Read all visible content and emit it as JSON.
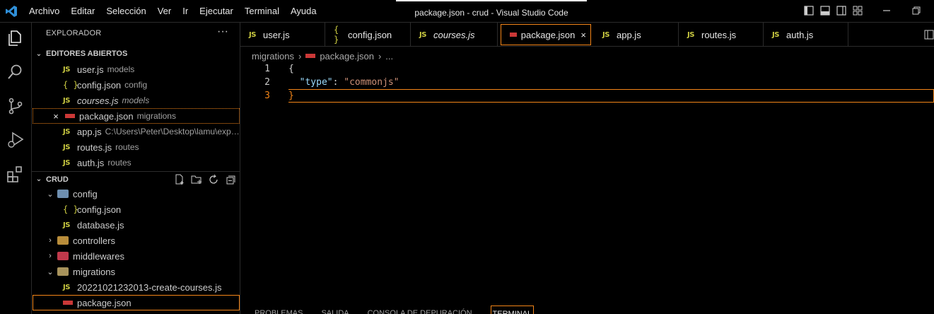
{
  "app": {
    "window_title": "package.json - crud - Visual Studio Code",
    "menu": [
      "Archivo",
      "Editar",
      "Selección",
      "Ver",
      "Ir",
      "Ejecutar",
      "Terminal",
      "Ayuda"
    ]
  },
  "sidebar": {
    "title": "EXPLORADOR",
    "more": "···",
    "open_editors": {
      "label": "EDITORES ABIERTOS",
      "items": [
        {
          "icon": "js",
          "name": "user.js",
          "desc": "models"
        },
        {
          "icon": "json",
          "name": "config.json",
          "desc": "config"
        },
        {
          "icon": "js",
          "name": "courses.js",
          "desc": "models"
        },
        {
          "icon": "npm",
          "name": "package.json",
          "desc": "migrations"
        },
        {
          "icon": "js",
          "name": "app.js",
          "desc": "C:\\Users\\Peter\\Desktop\\lamu\\expr..."
        },
        {
          "icon": "js",
          "name": "routes.js",
          "desc": "routes"
        },
        {
          "icon": "js",
          "name": "auth.js",
          "desc": "routes"
        }
      ]
    },
    "crud": {
      "label": "CRUD",
      "tree": [
        {
          "type": "folder",
          "name": "config",
          "open": true
        },
        {
          "type": "json",
          "name": "config.json"
        },
        {
          "type": "js",
          "name": "database.js"
        },
        {
          "type": "folder",
          "name": "controllers",
          "open": false
        },
        {
          "type": "folder",
          "name": "middlewares",
          "open": false
        },
        {
          "type": "folder",
          "name": "migrations",
          "open": true
        },
        {
          "type": "js",
          "name": "20221021232013-create-courses.js"
        },
        {
          "type": "npm",
          "name": "package.json"
        }
      ]
    }
  },
  "editor": {
    "tabs": [
      {
        "icon": "js",
        "label": "user.js"
      },
      {
        "icon": "json",
        "label": "config.json"
      },
      {
        "icon": "js",
        "label": "courses.js"
      },
      {
        "icon": "npm",
        "label": "package.json",
        "active": true,
        "close": "×"
      },
      {
        "icon": "js",
        "label": "app.js"
      },
      {
        "icon": "js",
        "label": "routes.js"
      },
      {
        "icon": "js",
        "label": "auth.js"
      }
    ],
    "breadcrumb": [
      "migrations",
      "package.json",
      "..."
    ],
    "lines": [
      {
        "n": "1",
        "text": "{"
      },
      {
        "n": "2",
        "key": "\"type\"",
        "sep": ": ",
        "value": "\"commonjs\""
      },
      {
        "n": "3",
        "text": "}"
      }
    ]
  },
  "panel": {
    "tabs": [
      "PROBLEMAS",
      "SALIDA",
      "CONSOLA DE DEPURACIÓN",
      "TERMINAL"
    ]
  },
  "icons": {
    "js_glyph": "JS",
    "json_glyph": "{ }",
    "close_glyph": "×"
  }
}
